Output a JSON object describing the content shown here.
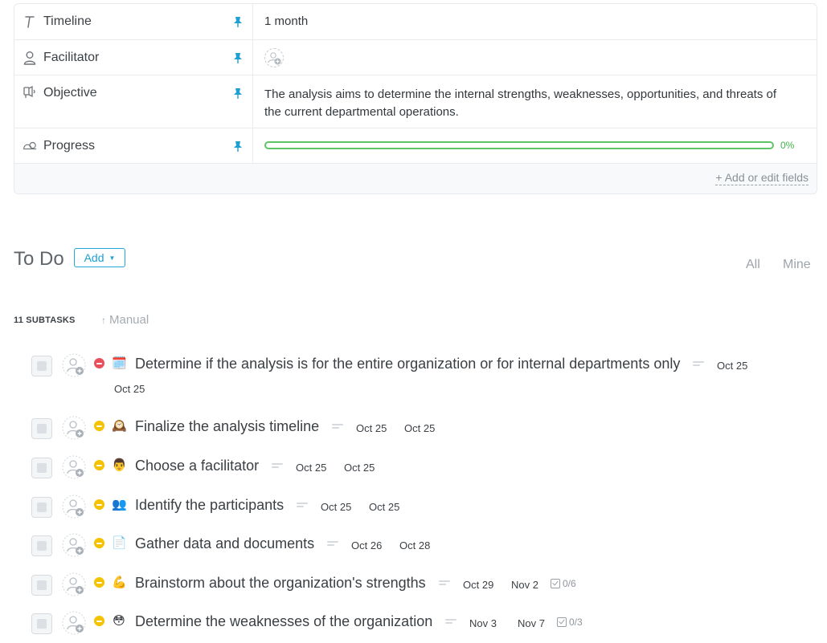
{
  "fields": [
    {
      "name": "Timeline",
      "icon": "text-icon",
      "value": "1 month"
    },
    {
      "name": "Facilitator",
      "icon": "person-icon",
      "value": ""
    },
    {
      "name": "Objective",
      "icon": "speaker-icon",
      "value": "The analysis aims to determine the internal strengths, weaknesses, opportunities, and threats of the current departmental operations."
    },
    {
      "name": "Progress",
      "icon": "progress-icon",
      "value_percent": 0,
      "value_label": "0%"
    }
  ],
  "add_fields_label": "+ Add or edit fields",
  "todo": {
    "title": "To Do",
    "add_label": "Add",
    "filter_all": "All",
    "filter_mine": "Mine",
    "subtasks_count": "11 SUBTASKS",
    "sort_label": "Manual"
  },
  "tasks": [
    {
      "name": "Determine if the analysis is for the entire organization or for internal departments only",
      "priority": "urgent",
      "emoji": "🗓️",
      "start": "Oct 25",
      "due": "Oct 25"
    },
    {
      "name": "Finalize the analysis timeline",
      "priority": "normal",
      "emoji": "🕰️",
      "start": "Oct 25",
      "due": "Oct 25"
    },
    {
      "name": "Choose a facilitator",
      "priority": "normal",
      "emoji": "👨",
      "start": "Oct 25",
      "due": "Oct 25"
    },
    {
      "name": "Identify the participants",
      "priority": "normal",
      "emoji": "👥",
      "start": "Oct 25",
      "due": "Oct 25"
    },
    {
      "name": "Gather data and documents",
      "priority": "normal",
      "emoji": "📄",
      "start": "Oct 26",
      "due": "Oct 28"
    },
    {
      "name": "Brainstorm about the organization's strengths",
      "priority": "normal",
      "emoji": "💪",
      "start": "Oct 29",
      "due": "Nov 2",
      "checklist": "0/6"
    },
    {
      "name": "Determine the weaknesses of the organization",
      "priority": "normal",
      "emoji": "😳",
      "start": "Nov 3",
      "due": "Nov 7",
      "checklist": "0/3"
    }
  ],
  "colors": {
    "accent": "#1ea0d3",
    "progress": "#5ec466",
    "priority_urgent": "#e8505b",
    "priority_normal": "#f5c200",
    "pin": "#1ea0d3"
  }
}
